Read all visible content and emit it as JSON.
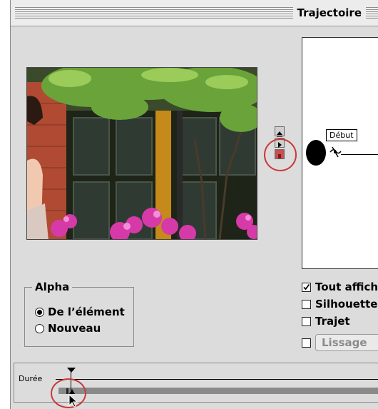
{
  "window": {
    "title": "Trajectoire"
  },
  "controls": {
    "icons": [
      "step-up-icon",
      "play-icon",
      "stop-icon"
    ]
  },
  "preview": {
    "start_label": "Début"
  },
  "options": {
    "tout_afficher": "Tout affich",
    "silhouette": "Silhouette",
    "trajet": "Trajet",
    "lissage": "Lissage",
    "tout_afficher_checked": true,
    "silhouette_checked": false,
    "trajet_checked": false,
    "lissage_checked": false
  },
  "alpha": {
    "title": "Alpha",
    "options": [
      {
        "label": "De l’élément",
        "selected": true
      },
      {
        "label": "Nouveau",
        "selected": false
      }
    ]
  },
  "timeline": {
    "label": "Durée"
  },
  "colors": {
    "highlight_circle": "#c83a3a",
    "window_bg": "#dcdcdc"
  }
}
